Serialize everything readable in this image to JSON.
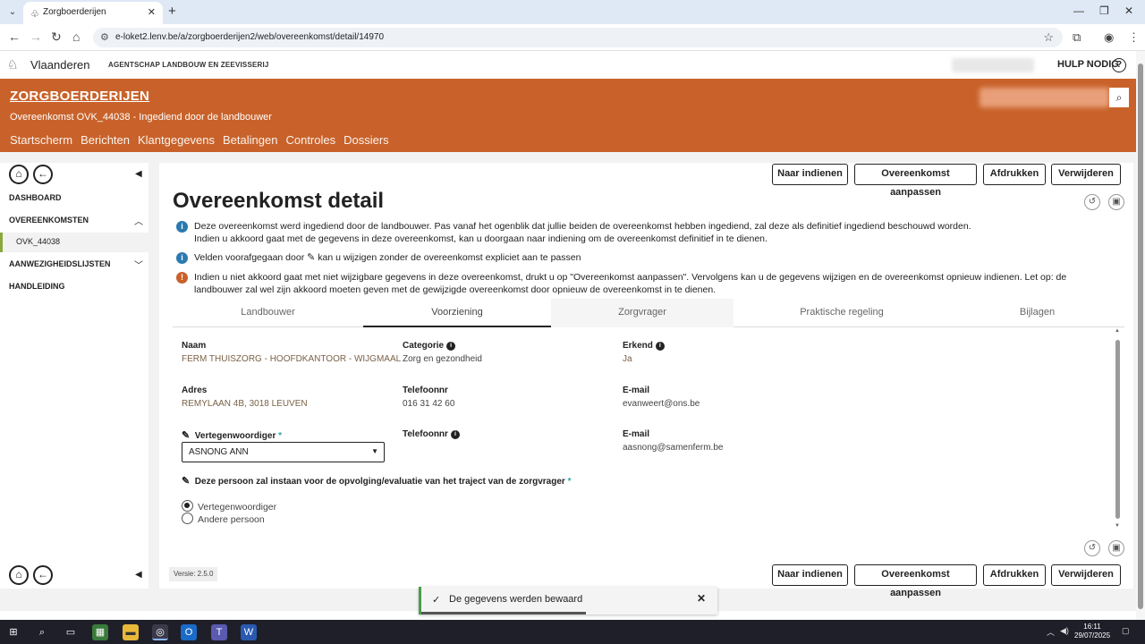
{
  "browser": {
    "tab_title": "Zorgboerderijen",
    "url": "e-loket2.lenv.be/a/zorgboerderijen2/web/overeenkomst/detail/14970"
  },
  "site": {
    "gov_name": "Vlaanderen",
    "agency": "AGENTSCHAP LANDBOUW EN ZEEVISSERIJ",
    "help": "HULP NODIG",
    "brand": "ZORGBOERDERIJEN",
    "subtitle": "Overeenkomst OVK_44038 - Ingediend door de landbouwer",
    "nav": [
      "Startscherm",
      "Berichten",
      "Klantgegevens",
      "Betalingen",
      "Controles",
      "Dossiers"
    ]
  },
  "sidebar": {
    "dashboard": "DASHBOARD",
    "overeenkomsten": "OVEREENKOMSTEN",
    "sub_item": "OVK_44038",
    "aanwezigheid": "AANWEZIGHEIDSLIJSTEN",
    "handleiding": "HANDLEIDING"
  },
  "actions": {
    "submit": "Naar indienen",
    "edit": "Overeenkomst aanpassen",
    "print": "Afdrukken",
    "delete": "Verwijderen"
  },
  "page": {
    "title": "Overeenkomst detail",
    "info1_line1": "Deze overeenkomst werd ingediend door de landbouwer. Pas vanaf het ogenblik dat jullie beiden de overeenkomst hebben ingediend, zal deze als definitief ingediend beschouwd worden.",
    "info1_line2": "Indien u akkoord gaat met de gegevens in deze overeenkomst, kan u doorgaan naar indiening om de overeenkomst definitief in te dienen.",
    "info2_a": "Velden voorafgegaan door",
    "info2_b": "kan u wijzigen zonder de overeenkomst expliciet aan te passen",
    "warn": "Indien u niet akkoord gaat met niet wijzigbare gegevens in deze overeenkomst, drukt u op \"Overeenkomst aanpassen\". Vervolgens kan u de gegevens wijzigen en de overeenkomst opnieuw indienen. Let op: de landbouwer zal wel zijn akkoord moeten geven met de gewijzigde overeenkomst door opnieuw de overeenkomst in te dienen.",
    "version": "Versie: 2.5.0"
  },
  "tabs": [
    "Landbouwer",
    "Voorziening",
    "Zorgvrager",
    "Praktische regeling",
    "Bijlagen"
  ],
  "form": {
    "naam_label": "Naam",
    "naam_value": "FERM THUISZORG - HOOFDKANTOOR - WIJGMAAL",
    "categorie_label": "Categorie",
    "categorie_value": "Zorg en gezondheid",
    "erkend_label": "Erkend",
    "erkend_value": "Ja",
    "adres_label": "Adres",
    "adres_value": "REMYLAAN 4B, 3018 LEUVEN",
    "tel_label": "Telefoonnr",
    "tel_value": "016 31 42 60",
    "email_label": "E-mail",
    "email_value": "evanweert@ons.be",
    "vert_label": "Vertegenwoordiger",
    "vert_value": "ASNONG ANN",
    "tel2_label": "Telefoonnr",
    "email2_label": "E-mail",
    "email2_value": "aasnong@samenferm.be",
    "question": "Deze persoon zal instaan voor de opvolging/evaluatie van het traject van de zorgvrager",
    "radio1": "Vertegenwoordiger",
    "radio2": "Andere persoon",
    "required_mark": "*"
  },
  "toast": {
    "message": "De gegevens werden bewaard"
  },
  "taskbar": {
    "time": "16:11",
    "date": "29/07/2025"
  },
  "colors": {
    "orange": "#c8622a",
    "success": "#4a9e4a",
    "info": "#2a7ab0",
    "warn": "#c8622a"
  }
}
